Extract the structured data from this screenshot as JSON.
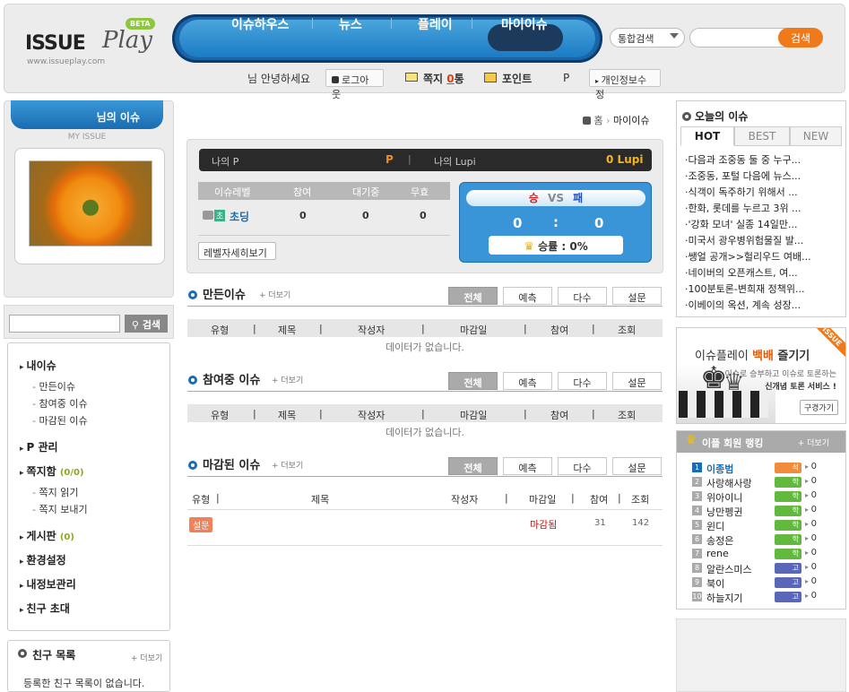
{
  "header": {
    "logo": {
      "name": "ISSUE",
      "play": "Play",
      "beta": "BETA",
      "url": "www.issueplay.com"
    },
    "nav": [
      "이슈하우스",
      "뉴스",
      "플레이",
      "마이이슈"
    ],
    "search": {
      "scope": "통합검색",
      "button": "검색"
    },
    "user": {
      "greeting": "님 안녕하세요",
      "logout": "로그아웃",
      "message_label": "쪽지",
      "message_count": "0",
      "message_unit": "통",
      "point_label": "포인트",
      "point_value": "P",
      "profile_edit": "개인정보수정"
    }
  },
  "left": {
    "my_issue_tab": "님의 이슈",
    "my_issue_caption": "MY ISSUE",
    "search_button": "검색",
    "menu": {
      "my_issue": "내이슈",
      "created": "만든이슈",
      "participating": "참여중 이슈",
      "closed": "마감된 이슈",
      "p_manage": "P 관리",
      "messages": "쪽지함",
      "messages_count": "(0/0)",
      "read_msg": "쪽지 읽기",
      "send_msg": "쪽지 보내기",
      "board": "게시판",
      "board_count": "(0)",
      "settings": "환경설정",
      "privacy": "내정보관리",
      "invite": "친구 초대"
    },
    "friends": {
      "title": "친구 목록",
      "more": "더보기",
      "empty": "등록한 친구 목록이 없습니다."
    }
  },
  "main": {
    "breadcrumb": {
      "home": "홈",
      "current": "마이이슈"
    },
    "points": {
      "my_p_label": "나의 P",
      "my_p_value": "P",
      "lupi_label": "나의 Lupi",
      "lupi_value": "0",
      "lupi_unit": "Lupi"
    },
    "level_table": {
      "headers": [
        "이슈레벨",
        "참여",
        "대기중",
        "무효"
      ],
      "level_badge": "초",
      "level_name": "초딩",
      "values": [
        "0",
        "0",
        "0"
      ]
    },
    "level_detail_button": "레벨자세히보기",
    "versus": {
      "win": "승",
      "vs": "VS",
      "lose": "패",
      "win_count": "0",
      "colon": ":",
      "lose_count": "0",
      "rate_label": "승률 :",
      "rate_value": "0%"
    },
    "tabs": [
      "전체",
      "예측",
      "다수",
      "설문"
    ],
    "more": "더보기",
    "columns": [
      "유형",
      "제목",
      "작성자",
      "마감일",
      "참여",
      "조회"
    ],
    "no_data": "데이터가 없습니다.",
    "sections": {
      "created": {
        "title": "만든이슈"
      },
      "participating": {
        "title": "참여중 이슈"
      },
      "closed": {
        "title": "마감된 이슈",
        "row": {
          "type": "설문",
          "deadline": "마감됨",
          "participants": "31",
          "views": "142"
        }
      }
    }
  },
  "right": {
    "today": {
      "title": "오늘의 이슈",
      "tabs": [
        "HOT",
        "BEST",
        "NEW"
      ],
      "items": [
        "다음과 조중동 둘 중 누구...",
        "조중동, 포털 다음에 뉴스...",
        "식객이 독주하기 위해서 ...",
        "한화, 롯데를 누르고 3위 ...",
        "'강화 모녀' 실종 14일만...",
        "미국서 광우병위험물질 발...",
        "쌩얼 공개>>헐리우드 여배...",
        "네이버의 오픈캐스트, 여...",
        "100분토론-변희재 정책위...",
        "이베이의 옥션, 계속 성장..."
      ]
    },
    "banner": {
      "line1a": "이슈플레이 ",
      "line1b": "백배",
      "line1c": " 즐기기",
      "line2": "이슈로 승부하고 이슈로 토론하는",
      "line3": "신개념 토론 서비스 !",
      "button": "구경가기",
      "ribbon": "ISSUE"
    },
    "ranking": {
      "title": "이플 회원 랭킹",
      "more": "더보기",
      "rows": [
        {
          "rank": "1",
          "name": "이종범",
          "badge": "석",
          "pts": "0"
        },
        {
          "rank": "2",
          "name": "사랑해사랑",
          "badge": "학",
          "pts": "0"
        },
        {
          "rank": "3",
          "name": "위아이니",
          "badge": "학",
          "pts": "0"
        },
        {
          "rank": "4",
          "name": "낭만펭귄",
          "badge": "학",
          "pts": "0"
        },
        {
          "rank": "5",
          "name": "윈디",
          "badge": "학",
          "pts": "0"
        },
        {
          "rank": "6",
          "name": "송정은",
          "badge": "학",
          "pts": "0"
        },
        {
          "rank": "7",
          "name": "rene",
          "badge": "학",
          "pts": "0"
        },
        {
          "rank": "8",
          "name": "알란스미스",
          "badge": "고",
          "pts": "0"
        },
        {
          "rank": "9",
          "name": "북이",
          "badge": "고",
          "pts": "0"
        },
        {
          "rank": "10",
          "name": "하늘지기",
          "badge": "고",
          "pts": "0"
        }
      ]
    }
  }
}
